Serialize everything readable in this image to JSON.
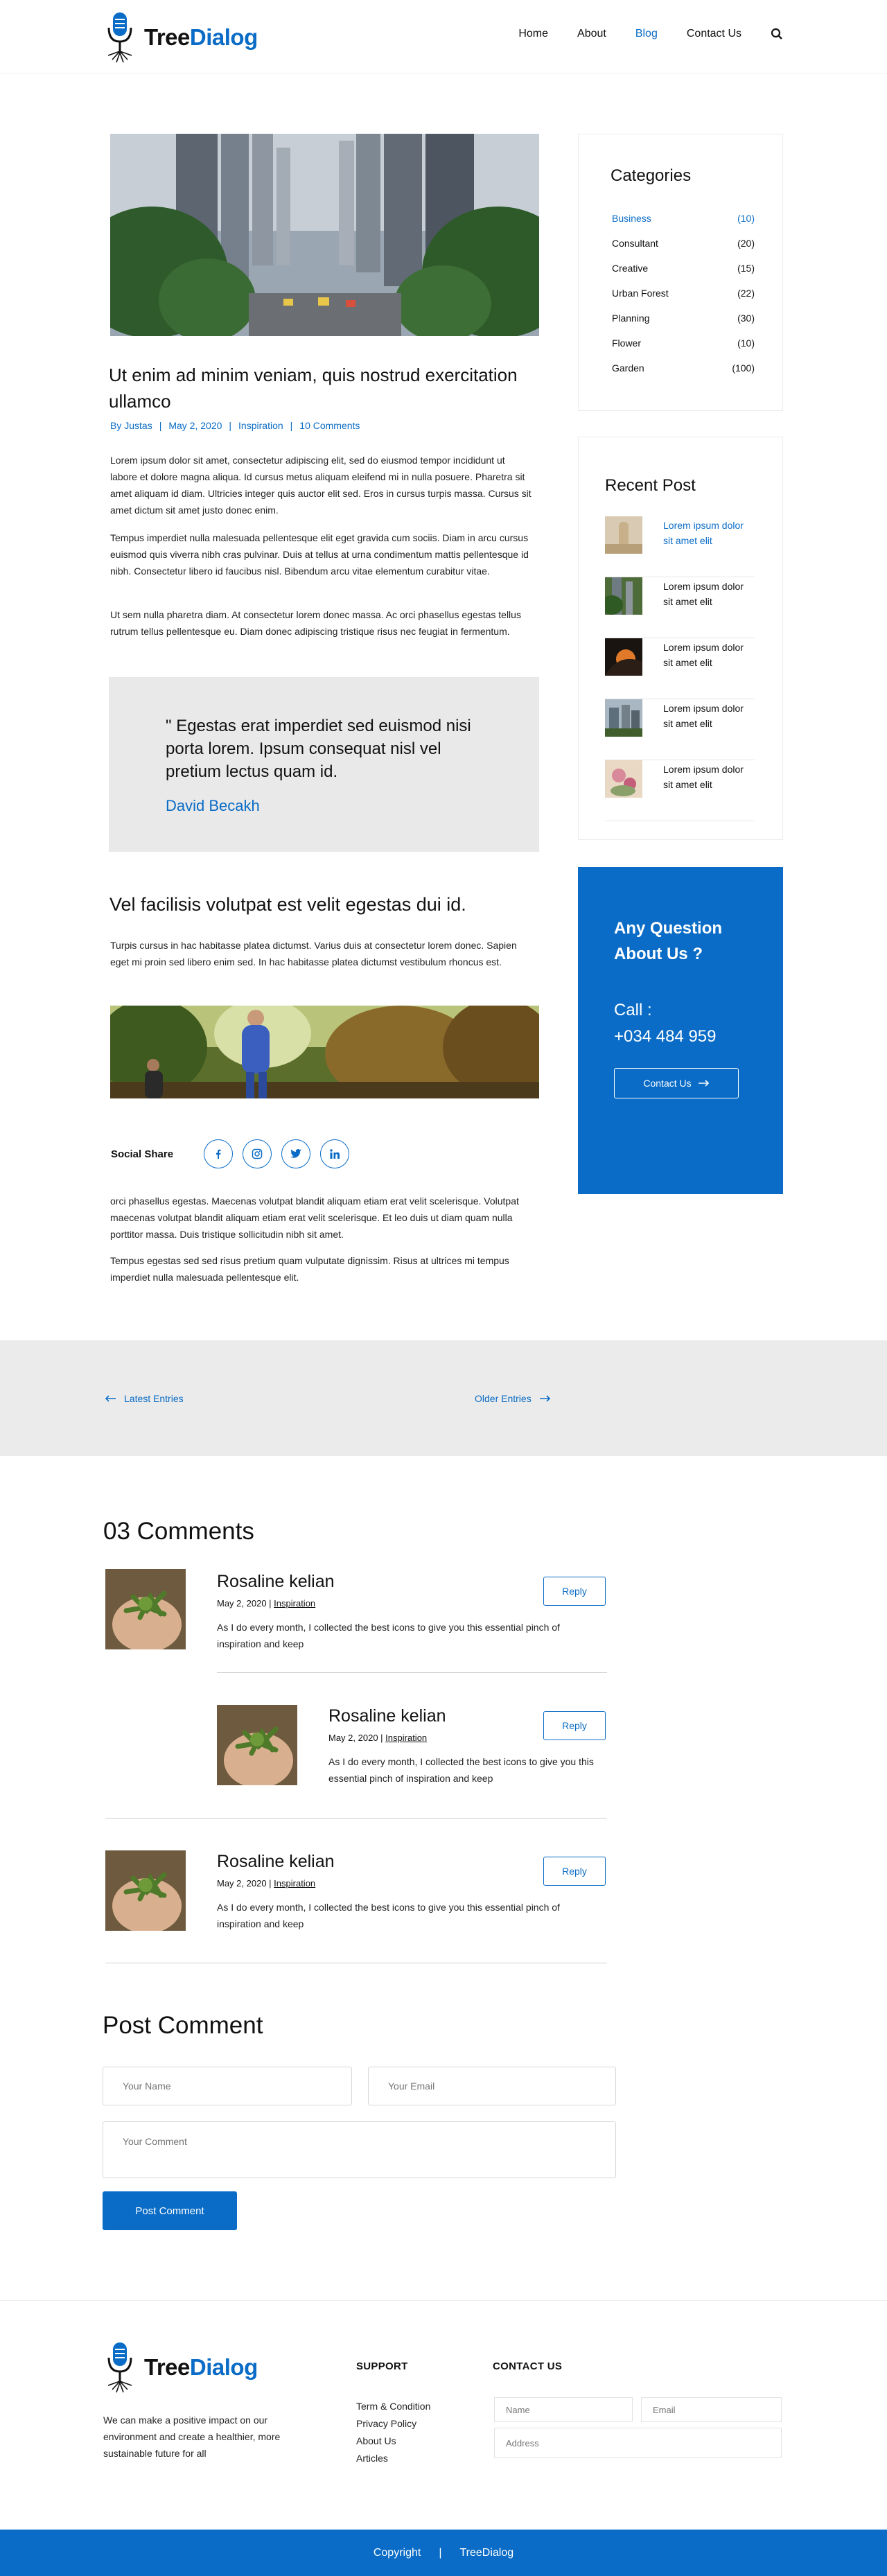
{
  "brand": {
    "part1": "Tree",
    "part2": "Dialog"
  },
  "nav": {
    "items": [
      "Home",
      "About",
      "Blog",
      "Contact Us"
    ],
    "active": "Blog"
  },
  "article": {
    "title": "Ut enim ad minim veniam, quis nostrud exercitation ullamco",
    "meta": {
      "author": "By Justas",
      "date": "May 2, 2020",
      "category": "Inspiration",
      "comments": "10 Comments"
    },
    "paragraphs": [
      "Lorem ipsum dolor sit amet, consectetur adipiscing elit, sed do eiusmod tempor incididunt ut labore et dolore magna aliqua. Id cursus metus aliquam eleifend mi in nulla posuere. Pharetra sit amet aliquam id diam. Ultricies integer quis auctor elit sed. Eros in cursus turpis massa. Cursus sit amet dictum sit amet justo donec enim.",
      "Tempus imperdiet nulla malesuada pellentesque elit eget gravida cum sociis. Diam in arcu cursus euismod quis viverra nibh cras pulvinar. Duis at tellus at urna condimentum mattis pellentesque id nibh. Consectetur libero id faucibus nisl. Bibendum arcu vitae elementum curabitur vitae.",
      "Ut sem nulla pharetra diam. At consectetur lorem donec massa. Ac orci phasellus egestas tellus rutrum tellus pellentesque eu. Diam donec adipiscing tristique risus nec feugiat in fermentum."
    ],
    "quote": {
      "text": "\" Egestas erat imperdiet sed euismod nisi porta lorem. Ipsum consequat nisl vel pretium lectus quam id.",
      "author": "David Becakh"
    },
    "subheading": "Vel facilisis volutpat est velit egestas dui id.",
    "sub_paragraph": "Turpis cursus in hac habitasse platea dictumst. Varius duis at consectetur lorem donec. Sapien eget mi proin sed libero enim sed. In hac habitasse platea dictumst vestibulum rhoncus est.",
    "social_label": "Social Share",
    "social_icons": [
      "facebook-icon",
      "instagram-icon",
      "twitter-icon",
      "linkedin-icon"
    ],
    "end_paragraphs": [
      "orci phasellus egestas. Maecenas volutpat blandit aliquam etiam erat velit scelerisque. Volutpat maecenas volutpat blandit aliquam etiam erat velit scelerisque. Et leo duis ut diam quam nulla porttitor massa. Duis tristique sollicitudin nibh sit amet.",
      "Tempus egestas sed sed risus pretium quam vulputate dignissim. Risus at ultrices mi tempus imperdiet nulla malesuada pellentesque elit."
    ]
  },
  "sidebar": {
    "categories_title": "Categories",
    "categories": [
      {
        "name": "Business",
        "count": "(10)"
      },
      {
        "name": "Consultant",
        "count": "(20)"
      },
      {
        "name": "Creative",
        "count": "(15)"
      },
      {
        "name": "Urban Forest",
        "count": "(22)"
      },
      {
        "name": "Planning",
        "count": "(30)"
      },
      {
        "name": "Flower",
        "count": "(10)"
      },
      {
        "name": "Garden",
        "count": "(100)"
      }
    ],
    "recent_title": "Recent Post",
    "recent_posts": [
      "Lorem ipsum dolor sit amet elit",
      "Lorem ipsum dolor sit amet elit",
      "Lorem ipsum dolor sit amet elit",
      "Lorem ipsum dolor sit amet elit",
      "Lorem ipsum dolor sit amet elit"
    ],
    "cta": {
      "title": "Any Question About Us ?",
      "call_label": "Call :",
      "phone": "+034 484 959",
      "button": "Contact Us"
    }
  },
  "pager": {
    "prev": "Latest Entries",
    "next": "Older Entries"
  },
  "comments": {
    "title": "03 Comments",
    "items": [
      {
        "name": "Rosaline kelian",
        "date": "May 2, 2020 |",
        "tag": "Inspiration",
        "text": "As I do every month, I collected the best icons to give you this essential pinch of inspiration and keep",
        "reply": "Reply"
      },
      {
        "name": "Rosaline kelian",
        "date": "May 2, 2020 |",
        "tag": "Inspiration",
        "text": "As I do every month, I collected the best icons to give you this essential pinch of inspiration and keep",
        "reply": "Reply"
      },
      {
        "name": "Rosaline kelian",
        "date": "May 2, 2020 |",
        "tag": "Inspiration",
        "text": "As I do every month, I collected the best icons to give you this essential pinch of inspiration and keep",
        "reply": "Reply"
      }
    ]
  },
  "post_comment": {
    "title": "Post Comment",
    "name_placeholder": "Your Name",
    "email_placeholder": "Your Email",
    "comment_placeholder": "Your Comment",
    "button": "Post Comment"
  },
  "footer": {
    "description": "We can make a positive impact on our environment and create a healthier, more sustainable future for all",
    "support_title": "SUPPORT",
    "support_links": [
      "Term & Condition",
      "Privacy Policy",
      "About Us",
      "Articles"
    ],
    "contact_title": "CONTACT US",
    "contact_name_placeholder": "Name",
    "contact_email_placeholder": "Email",
    "contact_address_placeholder": "Address",
    "copyright": "Copyright",
    "divider": "|",
    "brand": "TreeDialog"
  },
  "colors": {
    "accent": "#0a6cc6",
    "panel": "#e9e9e9",
    "pager_bg": "#ebebeb"
  }
}
